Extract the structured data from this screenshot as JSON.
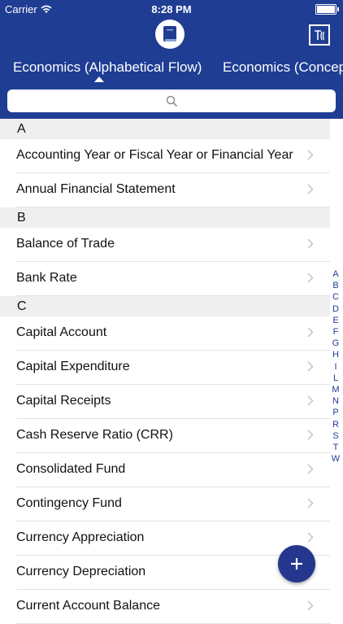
{
  "status_bar": {
    "carrier": "Carrier",
    "time": "8:28 PM"
  },
  "navbar": {
    "center_icon": "book-icon",
    "right_icon": "app-logo-icon"
  },
  "tabs": [
    {
      "label": "Economics (Alphabetical Flow)",
      "selected": true
    },
    {
      "label": "Economics (Concept"
    }
  ],
  "search": {
    "icon": "search-icon"
  },
  "sections": [
    {
      "header": "A",
      "items": [
        "Accounting Year or Fiscal Year or Financial Year",
        "Annual Financial Statement"
      ]
    },
    {
      "header": "B",
      "items": [
        "Balance of Trade",
        "Bank Rate"
      ]
    },
    {
      "header": "C",
      "items": [
        "Capital Account",
        "Capital Expenditure",
        "Capital Receipts",
        "Cash Reserve Ratio (CRR)",
        "Consolidated Fund",
        "Contingency Fund",
        "Currency Appreciation",
        "Currency Depreciation",
        "Current Account Balance"
      ]
    }
  ],
  "index_letters": [
    "A",
    "B",
    "C",
    "D",
    "E",
    "F",
    "G",
    "H",
    "I",
    "L",
    "M",
    "N",
    "P",
    "R",
    "S",
    "T",
    "W"
  ],
  "fab": {
    "label": "+"
  },
  "colors": {
    "primary": "#1f3d93",
    "fab": "#24368d"
  }
}
